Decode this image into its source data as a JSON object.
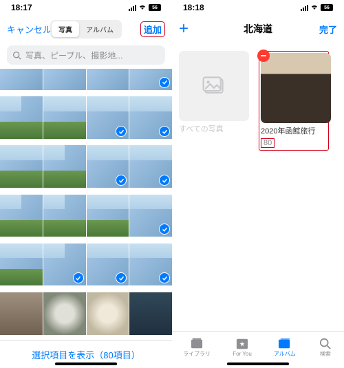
{
  "left": {
    "status_time": "18:17",
    "battery": "56",
    "nav": {
      "cancel": "キャンセル",
      "seg_photos": "写真",
      "seg_albums": "アルバム",
      "add": "追加"
    },
    "search_placeholder": "写真、ピープル、撮影地...",
    "footer_link": "選択項目を表示（80項目）"
  },
  "right": {
    "status_time": "18:18",
    "battery": "56",
    "nav": {
      "title": "北海道",
      "done": "完了"
    },
    "albums": [
      {
        "label": "すべての写真",
        "count": ""
      },
      {
        "label": "2020年函館旅行",
        "count": "80"
      }
    ],
    "tabs": {
      "library": "ライブラリ",
      "foryou": "For You",
      "albums": "アルバム",
      "search": "検索"
    }
  }
}
